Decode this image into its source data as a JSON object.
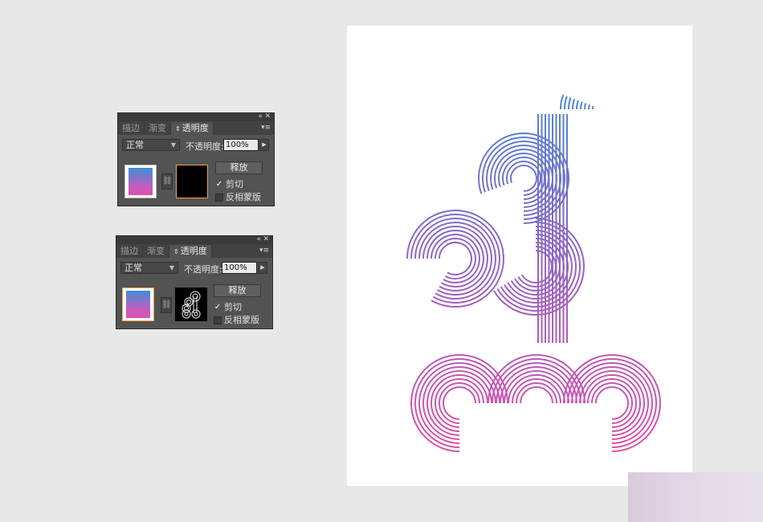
{
  "panels": [
    {
      "tabs": [
        "描边",
        "渐变",
        "透明度"
      ],
      "active_tab": "透明度",
      "blend_mode": "正常",
      "opacity_label": "不透明度:",
      "opacity_value": "100%",
      "release_button": "释放",
      "clip_label": "剪切",
      "clip_checked": true,
      "invert_label": "反相蒙版",
      "invert_checked": false,
      "mask_state": "empty-black"
    },
    {
      "tabs": [
        "描边",
        "渐变",
        "透明度"
      ],
      "active_tab": "透明度",
      "blend_mode": "正常",
      "opacity_label": "不透明度:",
      "opacity_value": "100%",
      "release_button": "释放",
      "clip_label": "剪切",
      "clip_checked": true,
      "invert_label": "反相蒙版",
      "invert_checked": false,
      "mask_state": "artwork-mask"
    }
  ],
  "colors": {
    "gradient_top": "#3d8fd6",
    "gradient_bottom": "#e24fa8",
    "panel_bg": "#535353",
    "canvas_bg": "#e8e8e8",
    "selection_highlight": "#f0a24b"
  },
  "icons": {
    "collapse": "double-chevron-left-icon",
    "close": "close-icon",
    "panel_menu": "panel-menu-icon",
    "link": "chain-link-icon",
    "dropdown": "caret-down-icon",
    "arrow": "caret-right-icon"
  }
}
